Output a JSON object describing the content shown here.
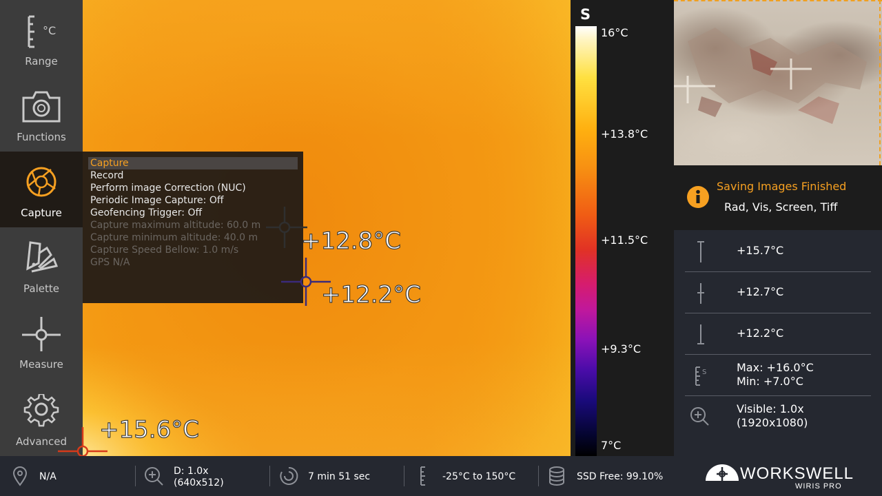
{
  "sidebar": {
    "items": [
      {
        "label": "Range",
        "icon": "range-icon"
      },
      {
        "label": "Functions",
        "icon": "camera-icon"
      },
      {
        "label": "Capture",
        "icon": "aperture-icon",
        "active": true
      },
      {
        "label": "Palette",
        "icon": "palette-icon"
      },
      {
        "label": "Measure",
        "icon": "crosshair-icon"
      },
      {
        "label": "Advanced",
        "icon": "gear-icon"
      }
    ],
    "range_unit": "°C"
  },
  "capture_menu": {
    "items": [
      {
        "label": "Capture",
        "selected": true,
        "enabled": true
      },
      {
        "label": "Record",
        "enabled": true
      },
      {
        "label": "Perform image Correction (NUC)",
        "enabled": true
      },
      {
        "label": "Periodic Image Capture: Off",
        "enabled": true
      },
      {
        "label": "Geofencing Trigger: Off",
        "enabled": true
      },
      {
        "label": "Capture maximum altitude: 60.0 m",
        "enabled": false
      },
      {
        "label": "Capture minimum altitude: 40.0 m",
        "enabled": false
      },
      {
        "label": "Capture Speed Bellow: 1.0 m/s",
        "enabled": false
      },
      {
        "label": "GPS N/A",
        "enabled": false
      }
    ]
  },
  "spots": [
    {
      "label": "+12.8°C"
    },
    {
      "label": "+12.2°C"
    },
    {
      "label": "+15.6°C"
    }
  ],
  "scale": {
    "mode": "S",
    "ticks": [
      "16°C",
      "+13.8°C",
      "+11.5°C",
      "+9.3°C",
      "7°C"
    ]
  },
  "notification": {
    "title": "Saving Images Finished",
    "detail": "Rad, Vis, Screen, Tiff",
    "icon": "info-icon"
  },
  "readings": {
    "max_spot": "+15.7°C",
    "center_spot": "+12.7°C",
    "min_spot": "+12.2°C",
    "range_max": "Max: +16.0°C",
    "range_min": "Min: +7.0°C",
    "visible_zoom": "Visible: 1.0x",
    "visible_res": "(1920x1080)"
  },
  "bottom": {
    "gps": "N/A",
    "digital_zoom": "D: 1.0x",
    "digital_res": "(640x512)",
    "timer": "7 min 51 sec",
    "temp_range": "-25°C to 150°C",
    "ssd": "SSD Free: 99.10%"
  },
  "brand": {
    "name": "WORKSWELL",
    "product": "WIRIS PRO"
  },
  "colors": {
    "accent": "#f6a021",
    "panel": "#252830",
    "sidebar": "#3c3c3c"
  }
}
